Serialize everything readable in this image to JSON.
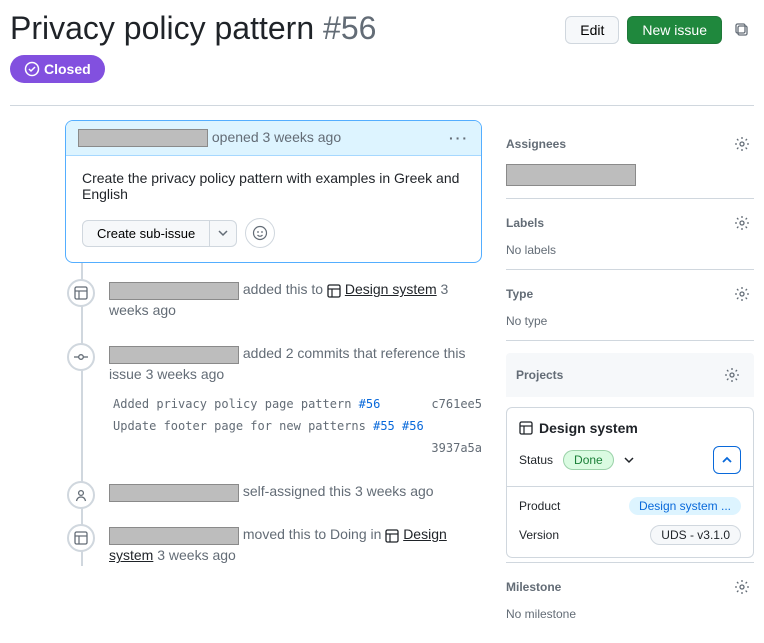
{
  "header": {
    "title": "Privacy policy pattern",
    "number": "#56",
    "edit": "Edit",
    "new_issue": "New issue"
  },
  "status": {
    "label": "Closed"
  },
  "comment": {
    "opened_text": "opened 3 weeks ago",
    "body": "Create the privacy policy pattern with examples in Greek and English",
    "create_sub": "Create sub-issue"
  },
  "timeline": [
    {
      "icon": "table",
      "text_suffix": " added this to ",
      "link": "Design system",
      "time": " 3 weeks ago"
    },
    {
      "icon": "commit",
      "text_suffix": " added 2 commits that reference this issue 3 weeks ago",
      "commits": [
        {
          "msg": "Added privacy policy page pattern ",
          "ref": "#56",
          "sha": "c761ee5"
        },
        {
          "msg": "Update footer page for new patterns ",
          "ref": "#55",
          "ref2": "#56",
          "sha": "3937a5a"
        }
      ]
    },
    {
      "icon": "person",
      "text_suffix": " self-assigned this 3 weeks ago"
    },
    {
      "icon": "table",
      "text_suffix": " moved this to Doing in ",
      "link": "Design system",
      "time": " 3 weeks ago"
    }
  ],
  "sidebar": {
    "assignees": {
      "label": "Assignees"
    },
    "labels": {
      "label": "Labels",
      "value": "No labels"
    },
    "type": {
      "label": "Type",
      "value": "No type"
    },
    "projects": {
      "label": "Projects",
      "name": "Design system",
      "status_label": "Status",
      "status_value": "Done",
      "product_label": "Product",
      "product_value": "Design system ...",
      "version_label": "Version",
      "version_value": "UDS - v3.1.0"
    },
    "milestone": {
      "label": "Milestone",
      "value": "No milestone"
    }
  }
}
